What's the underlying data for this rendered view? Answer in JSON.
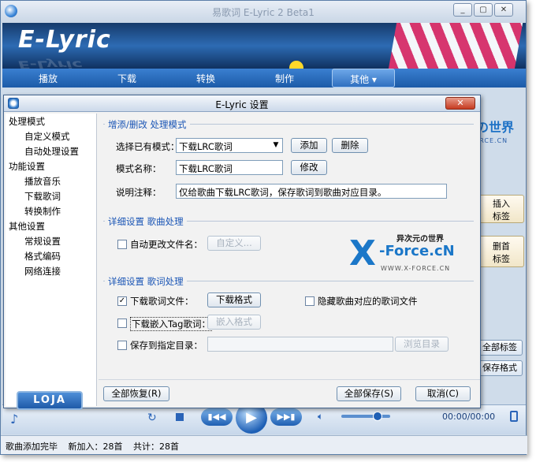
{
  "app": {
    "title": "易歌词 E-Lyric 2 Beta1",
    "logo_text": "E-Lyric",
    "window_buttons": {
      "minimize": "_",
      "restore": "▢",
      "close": "✕"
    }
  },
  "menu": {
    "items": [
      {
        "label": "播放"
      },
      {
        "label": "下载"
      },
      {
        "label": "转换"
      },
      {
        "label": "制作"
      },
      {
        "label": "其他 ▾"
      }
    ]
  },
  "brand": {
    "name": "异次元の世界",
    "url": "WWW.X-FORCE.CN"
  },
  "right_panel": {
    "insert_tag": "插入\n标签",
    "delete_tag": "删首\n标签",
    "all_tags": "全部标签",
    "save_format": "保存格式"
  },
  "player": {
    "time": "00:00/00:00"
  },
  "status": {
    "message": "歌曲添加完毕",
    "new_added": "新加入：28首",
    "total": "共计：28首"
  },
  "dialog": {
    "title": "E-Lyric 设置",
    "close_label": "✕",
    "tree": {
      "groups": [
        {
          "label": "处理模式",
          "children": [
            "自定义模式",
            "自动处理设置"
          ]
        },
        {
          "label": "功能设置",
          "children": [
            "播放音乐",
            "下载歌词",
            "转换制作"
          ]
        },
        {
          "label": "其他设置",
          "children": [
            "常规设置",
            "格式编码",
            "网络连接"
          ]
        }
      ],
      "logo": "LOJA"
    },
    "section_mode": {
      "title": "增添/删改 处理模式",
      "select_label": "选择已有模式：",
      "select_value": "下载LRC歌词",
      "add_button": "添加",
      "delete_button": "删除",
      "name_label": "模式名称：",
      "name_value": "下载LRC歌词",
      "modify_button": "修改",
      "desc_label": "说明注释：",
      "desc_value": "仅给歌曲下载LRC歌词，保存歌词到歌曲对应目录。"
    },
    "section_song": {
      "title": "详细设置 歌曲处理",
      "auto_rename_label": "自动更改文件名：",
      "auto_rename_checked": false,
      "custom_button": "自定义..."
    },
    "section_lyric": {
      "title": "详细设置 歌词处理",
      "download_lyric_label": "下载歌词文件：",
      "download_lyric_checked": true,
      "download_format_button": "下载格式",
      "hide_lyric_label": "隐藏歌曲对应的歌词文件",
      "hide_lyric_checked": false,
      "embed_tag_label": "下载嵌入Tag歌词：",
      "embed_tag_checked": false,
      "embed_format_button": "嵌入格式",
      "save_dir_label": "保存到指定目录：",
      "save_dir_checked": false,
      "save_dir_value": "",
      "browse_button": "浏览目录"
    },
    "footer": {
      "restore_all": "全部恢复(R)",
      "save_all": "全部保存(S)",
      "cancel": "取消(C)"
    },
    "watermark": {
      "x": "X",
      "text": "-Force.cN",
      "cn": "异次元の世界",
      "url": "WWW.X-FORCE.CN"
    }
  }
}
